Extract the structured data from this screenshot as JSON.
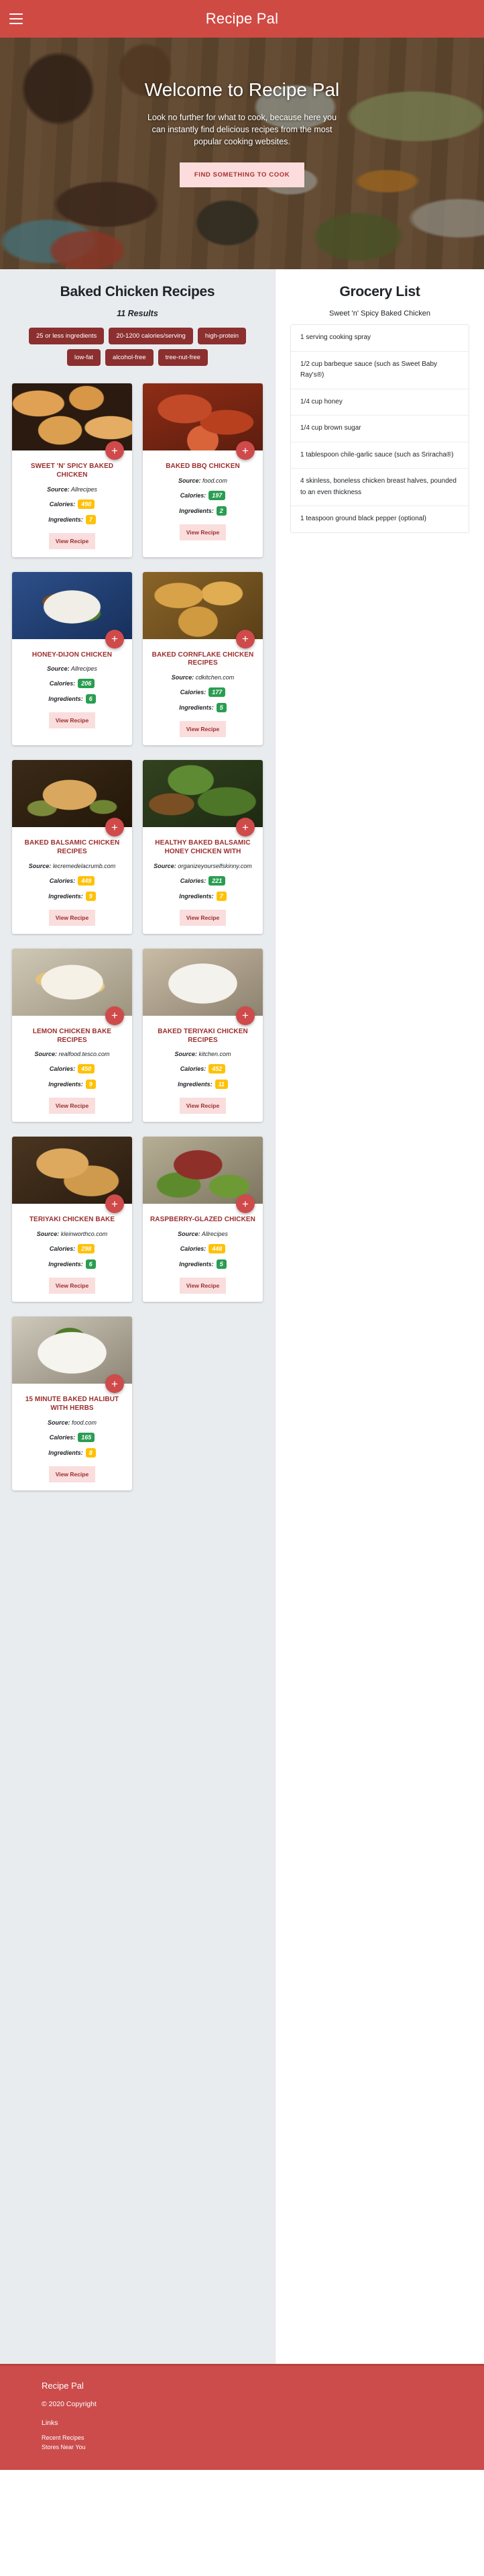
{
  "navbar": {
    "title": "Recipe Pal",
    "menu_icon": "hamburger-menu-icon"
  },
  "hero": {
    "title": "Welcome to Recipe Pal",
    "subtitle": "Look no further for what to cook, because here you can instantly find delicious recipes from the most popular cooking websites.",
    "cta": "FIND SOMETHING TO COOK"
  },
  "results": {
    "title": "Baked Chicken Recipes",
    "count": "11 Results",
    "tags": [
      "25 or less ingredients",
      "20-1200 calories/serving",
      "high-protein",
      "low-fat",
      "alcohol-free",
      "tree-nut-free"
    ],
    "labels": {
      "source": "Source:",
      "calories": "Calories:",
      "ingredients": "Ingredients:",
      "view": "View Recipe",
      "add_icon": "plus-icon"
    },
    "cards": [
      {
        "title": "Sweet 'n' Spicy Baked Chicken",
        "source": "Allrecipes",
        "calories": "490",
        "calories_color": "warn",
        "ingredients": "7",
        "ingredients_color": "warn",
        "img": "sticky-glazed-chicken-pieces-in-dark-pan"
      },
      {
        "title": "Baked BBQ Chicken",
        "source": "food.com",
        "calories": "197",
        "calories_color": "green",
        "ingredients": "2",
        "ingredients_color": "green",
        "img": "bbq-sauce-covered-chicken-in-red-dish"
      },
      {
        "title": "Honey-Dijon Chicken",
        "source": "Allrecipes",
        "calories": "206",
        "calories_color": "green",
        "ingredients": "6",
        "ingredients_color": "green",
        "img": "chicken-with-rice-and-greens-on-blue-plate"
      },
      {
        "title": "Baked Cornflake Chicken Recipes",
        "source": "cdkitchen.com",
        "calories": "177",
        "calories_color": "green",
        "ingredients": "5",
        "ingredients_color": "green",
        "img": "golden-crumbed-chicken-pieces-on-tray"
      },
      {
        "title": "Baked Balsamic Chicken Recipes",
        "source": "lecremedelacrumb.com",
        "calories": "449",
        "calories_color": "warn",
        "ingredients": "9",
        "ingredients_color": "warn",
        "img": "whole-roast-chicken-with-herbs-in-pan"
      },
      {
        "title": "Healthy Baked Balsamic Honey Chicken With",
        "source": "organizeyourselfskinny.com",
        "calories": "221",
        "calories_color": "green",
        "ingredients": "7",
        "ingredients_color": "warn",
        "img": "chicken-thighs-with-green-beans-in-skillet"
      },
      {
        "title": "Lemon Chicken Bake Recipes",
        "source": "realfood.tesco.com",
        "calories": "450",
        "calories_color": "warn",
        "ingredients": "9",
        "ingredients_color": "warn",
        "img": "lemon-chicken-breasts-in-white-baking-dish"
      },
      {
        "title": "Baked Teriyaki Chicken Recipes",
        "source": "kitchen.com",
        "calories": "452",
        "calories_color": "warn",
        "ingredients": "11",
        "ingredients_color": "warn",
        "img": "teriyaki-chicken-with-corn-on-white-plate"
      },
      {
        "title": "Teriyaki Chicken Bake",
        "source": "kleinworthco.com",
        "calories": "298",
        "calories_color": "warn",
        "ingredients": "6",
        "ingredients_color": "green",
        "img": "glazed-chicken-breasts-in-skillet"
      },
      {
        "title": "Raspberry-Glazed Chicken",
        "source": "Allrecipes",
        "calories": "448",
        "calories_color": "warn",
        "ingredients": "5",
        "ingredients_color": "green",
        "img": "raspberry-glazed-chicken-on-lettuce"
      },
      {
        "title": "15 Minute Baked Halibut With Herbs",
        "source": "food.com",
        "calories": "165",
        "calories_color": "green",
        "ingredients": "8",
        "ingredients_color": "warn",
        "img": "halibut-with-herbs-and-black-rice-on-white-plate"
      }
    ]
  },
  "grocery": {
    "title": "Grocery List",
    "recipe": "Sweet 'n' Spicy Baked Chicken",
    "items": [
      "1 serving cooking spray",
      "1/2 cup barbeque sauce (such as Sweet Baby Ray's®)",
      "1/4 cup honey",
      "1/4 cup brown sugar",
      "1 tablespoon chile-garlic sauce (such as Sriracha®)",
      "4 skinless, boneless chicken breast halves, pounded to an even thickness",
      "1 teaspoon ground black pepper (optional)"
    ]
  },
  "footer": {
    "brand": "Recipe Pal",
    "copyright": "© 2020 Copyright",
    "links_heading": "Links",
    "links": [
      "Recent Recipes",
      "Stores Near You"
    ]
  },
  "colors": {
    "brand_red": "#d04a44",
    "tag_red": "#8c2f2f",
    "title_red": "#9b2d2d",
    "badge_warn": "#ffc107",
    "badge_green": "#2a9d52",
    "results_bg": "#e9ecef"
  }
}
